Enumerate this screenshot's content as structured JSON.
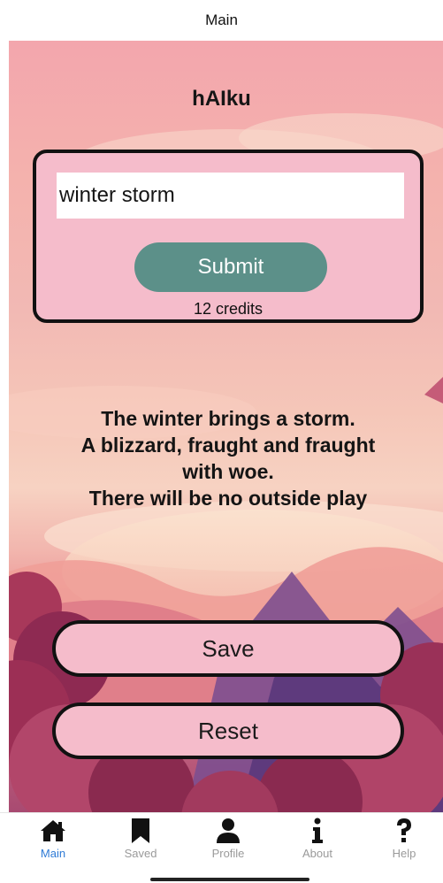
{
  "nav": {
    "title": "Main"
  },
  "app": {
    "title": "hAIku"
  },
  "form": {
    "input_value": "winter storm",
    "submit_label": "Submit",
    "credits": "12 credits"
  },
  "haiku": {
    "lines": [
      "The winter brings a storm.",
      "A blizzard, fraught and fraught",
      "with woe.",
      "There will be no outside play"
    ]
  },
  "actions": {
    "save_label": "Save",
    "reset_label": "Reset"
  },
  "tabs": [
    {
      "label": "Main",
      "icon": "home-icon",
      "active": true
    },
    {
      "label": "Saved",
      "icon": "bookmark-icon",
      "active": false
    },
    {
      "label": "Profile",
      "icon": "person-icon",
      "active": false
    },
    {
      "label": "About",
      "icon": "info-icon",
      "active": false
    },
    {
      "label": "Help",
      "icon": "question-icon",
      "active": false
    }
  ],
  "colors": {
    "accent_active_tab": "#2f7bd6",
    "submit_button": "#5c9089",
    "card_fill": "#f5bccb"
  }
}
